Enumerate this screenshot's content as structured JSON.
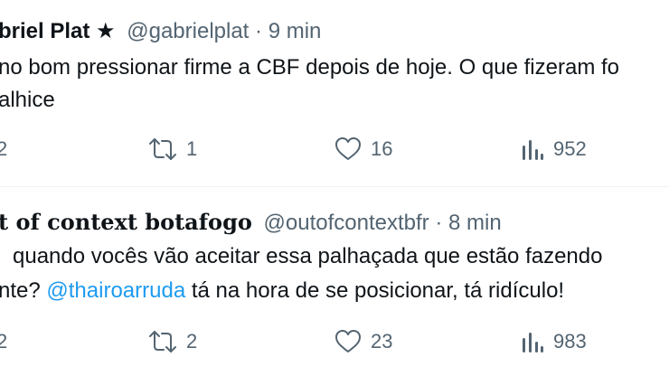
{
  "tweets": [
    {
      "author": "briel Plat",
      "star": "★",
      "handle": "@gabrielplat",
      "separator": "·",
      "time": "9 min",
      "line1": "no bom pressionar firme a CBF depois de hoje. O que fizeram fo",
      "line2": "alhice",
      "actions": {
        "replies": "2",
        "retweets": "1",
        "likes": "16",
        "views": "952"
      }
    },
    {
      "author": "t of context botafogo",
      "handle": "@outofcontextbfr",
      "separator": "·",
      "time": "8 min",
      "line1": "quando vocês vão aceitar essa palhaçada que estão fazendo",
      "line2_prefix": "nte?",
      "mention": "@thairoarruda",
      "line2_suffix": " tá na hora de se posicionar, tá ridículo!",
      "actions": {
        "replies": "2",
        "retweets": "2",
        "likes": "23",
        "views": "983"
      }
    }
  ]
}
